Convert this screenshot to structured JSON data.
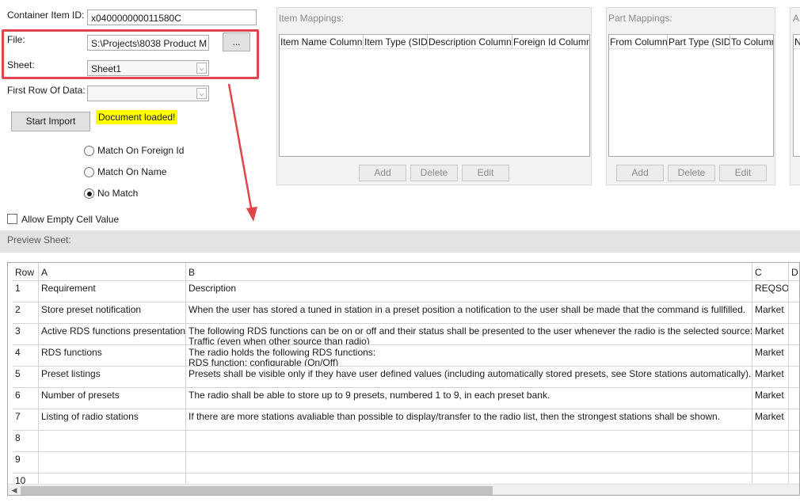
{
  "form": {
    "container_item_id_label": "Container Item ID:",
    "container_item_id_value": "x040000000011580C",
    "file_label": "File:",
    "file_value": "S:\\Projects\\8038 Product M",
    "browse_label": "...",
    "sheet_label": "Sheet:",
    "sheet_value": "Sheet1",
    "first_row_label": "First Row Of Data:",
    "first_row_value": "",
    "start_import_label": "Start Import",
    "status_badge": "Document loaded!",
    "match_options": [
      {
        "label": "Match On Foreign Id",
        "selected": false
      },
      {
        "label": "Match On Name",
        "selected": false
      },
      {
        "label": "No Match",
        "selected": true
      }
    ],
    "allow_empty_label": "Allow Empty Cell Value",
    "allow_empty_checked": false
  },
  "item_mappings": {
    "title": "Item Mappings:",
    "columns": [
      "Item Name Column",
      "Item Type (SID)",
      "Description Column",
      "Foreign Id Column"
    ],
    "add": "Add",
    "delete": "Delete",
    "edit": "Edit"
  },
  "part_mappings": {
    "title": "Part Mappings:",
    "columns": [
      "From Column",
      "Part Type (SID)",
      "To Column"
    ],
    "add": "Add",
    "delete": "Delete",
    "edit": "Edit"
  },
  "third_panel": {
    "title": "A",
    "column_initial": "N"
  },
  "preview": {
    "label": "Preview Sheet:",
    "headers": [
      "Row",
      "A",
      "B",
      "C",
      "D"
    ],
    "rows": [
      [
        "1",
        "Requirement",
        "Description",
        "REQSO"
      ],
      [
        "2",
        "Store preset notification",
        "When the user has stored a tuned in station in a preset position a notification to the user shall be made that the command is fullfilled.",
        "Market"
      ],
      [
        "3",
        "Active RDS functions presentation",
        "The following RDS functions can be on or off and their status shall be presented to the user whenever the radio is the selected source:",
        "Market"
      ],
      [
        "4",
        "RDS functions",
        "The radio holds the following RDS functions:",
        "Market"
      ],
      [
        "5",
        "Preset listings",
        "Presets shall be visible only if they have user defined values (including automatically stored presets, see Store stations automatically).",
        "Market"
      ],
      [
        "6",
        "Number of presets",
        "The radio shall be able to store up to 9 presets, numbered 1 to 9, in each preset bank.",
        "Market"
      ],
      [
        "7",
        "Listing of radio stations",
        "If there are more stations avaliable than possible to display/transfer to the radio list, then the strongest stations shall be shown.",
        "Market"
      ],
      [
        "8",
        "",
        "",
        ""
      ],
      [
        "9",
        "",
        "",
        ""
      ],
      [
        "10",
        "",
        "",
        ""
      ]
    ],
    "row3_overflow": "Traffic (even when other source than radio)",
    "row4_overflow": "RDS function: configurable (On/Off)"
  },
  "colors": {
    "highlight": "#e0444c",
    "badge_bg": "#ffff00"
  }
}
